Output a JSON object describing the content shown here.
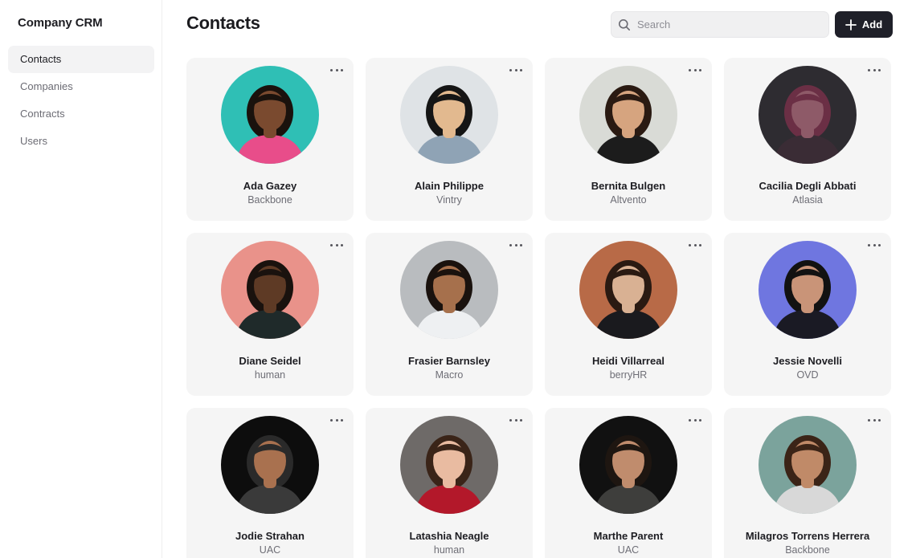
{
  "app": {
    "title": "Company CRM"
  },
  "sidebar": {
    "items": [
      {
        "label": "Contacts",
        "active": true
      },
      {
        "label": "Companies",
        "active": false
      },
      {
        "label": "Contracts",
        "active": false
      },
      {
        "label": "Users",
        "active": false
      }
    ]
  },
  "header": {
    "title": "Contacts",
    "search_placeholder": "Search",
    "add_label": "Add"
  },
  "contacts": [
    {
      "name": "Ada Gazey",
      "company": "Backbone",
      "bg": "#2fbfb5",
      "skin": "#7a4a2f",
      "hair": "#1a120d",
      "shirt": "#e84d8a"
    },
    {
      "name": "Alain Philippe",
      "company": "Vintry",
      "bg": "#dfe3e6",
      "skin": "#e2b98f",
      "hair": "#151515",
      "shirt": "#8fa3b5"
    },
    {
      "name": "Bernita Bulgen",
      "company": "Altvento",
      "bg": "#d9dbd6",
      "skin": "#d6a47f",
      "hair": "#2a1a12",
      "shirt": "#1c1c1c"
    },
    {
      "name": "Cacilia Degli Abbati",
      "company": "Atlasia",
      "bg": "#2e2c31",
      "skin": "#8e5a68",
      "hair": "#6b2f45",
      "shirt": "#3a2c35"
    },
    {
      "name": "Diane Seidel",
      "company": "human",
      "bg": "#e9928a",
      "skin": "#5e3a25",
      "hair": "#1a120e",
      "shirt": "#1f2a2a"
    },
    {
      "name": "Frasier Barnsley",
      "company": "Macro",
      "bg": "#b9bcbf",
      "skin": "#a6704c",
      "hair": "#1a120e",
      "shirt": "#eef0f2"
    },
    {
      "name": "Heidi Villarreal",
      "company": "berryHR",
      "bg": "#b86a47",
      "skin": "#d9b193",
      "hair": "#2a1a12",
      "shirt": "#1a1a1e"
    },
    {
      "name": "Jessie Novelli",
      "company": "OVD",
      "bg": "#6f76e0",
      "skin": "#c99478",
      "hair": "#121212",
      "shirt": "#1a1a24"
    },
    {
      "name": "Jodie Strahan",
      "company": "UAC",
      "bg": "#0d0d0d",
      "skin": "#a9714f",
      "hair": "#2a2a2a",
      "shirt": "#3a3a3a"
    },
    {
      "name": "Latashia Neagle",
      "company": "human",
      "bg": "#6e6a68",
      "skin": "#e9bba1",
      "hair": "#3a2418",
      "shirt": "#b3182a"
    },
    {
      "name": "Marthe Parent",
      "company": "UAC",
      "bg": "#111111",
      "skin": "#c08c6d",
      "hair": "#1e1611",
      "shirt": "#3e3e3c"
    },
    {
      "name": "Milagros Torrens Herrera",
      "company": "Backbone",
      "bg": "#7ba39c",
      "skin": "#c08a68",
      "hair": "#3b2417",
      "shirt": "#d8d8d8"
    }
  ]
}
